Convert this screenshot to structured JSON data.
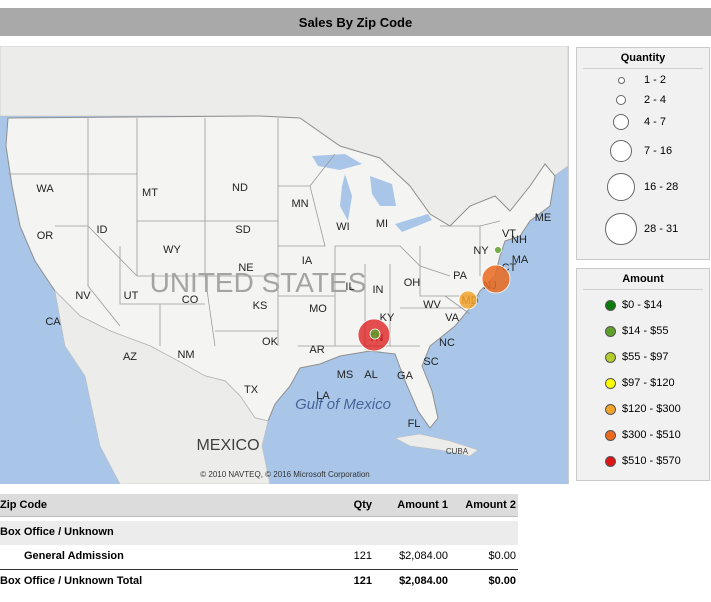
{
  "report": {
    "title": "Sales By Zip Code"
  },
  "map": {
    "copyright": "© 2010 NAVTEQ, © 2016 Microsoft Corporation",
    "country_label": "UNITED STATES",
    "water_label": "Gulf of Mexico",
    "neighbor_labels": [
      "MEXICO",
      "CUBA"
    ],
    "state_labels": [
      "WA",
      "MT",
      "ND",
      "MN",
      "OR",
      "ID",
      "SD",
      "WI",
      "MI",
      "WY",
      "NE",
      "IA",
      "NV",
      "UT",
      "CO",
      "IL",
      "IN",
      "OH",
      "PA",
      "NY",
      "VT",
      "NH",
      "ME",
      "MA",
      "CT",
      "NJ",
      "MD",
      "WV",
      "VA",
      "KS",
      "MO",
      "KY",
      "CA",
      "OK",
      "TN",
      "NC",
      "AR",
      "AZ",
      "NM",
      "SC",
      "MS",
      "AL",
      "GA",
      "TX",
      "LA",
      "FL"
    ],
    "colors": {
      "land": "#f4f4f2",
      "water": "#a9c6e8",
      "border": "#9a9a9a"
    }
  },
  "quantity_legend": {
    "title": "Quantity",
    "items": [
      "1 - 2",
      "2 - 4",
      "4 - 7",
      "7 - 16",
      "16 - 28",
      "28 - 31"
    ]
  },
  "amount_legend": {
    "title": "Amount",
    "items": [
      {
        "label": "$0 - $14",
        "color": "#0a7a0a"
      },
      {
        "label": "$14 - $55",
        "color": "#5ea02a"
      },
      {
        "label": "$55 - $97",
        "color": "#b4cc2e"
      },
      {
        "label": "$97 - $120",
        "color": "#ffff00"
      },
      {
        "label": "$120 - $300",
        "color": "#f2a32c"
      },
      {
        "label": "$300 - $510",
        "color": "#ea6a1e"
      },
      {
        "label": "$510 - $570",
        "color": "#dd1515"
      }
    ]
  },
  "bubbles": [
    {
      "location": "TN",
      "quantity_range": "28 - 31",
      "amount_range": "$510 - $570",
      "color": "#dd1515"
    },
    {
      "location": "TN",
      "quantity_range": "1 - 2",
      "amount_range": "$0 - $14",
      "color": "#5ea02a"
    },
    {
      "location": "NJ",
      "quantity_range": "16 - 28",
      "amount_range": "$300 - $510",
      "color": "#ea6a1e"
    },
    {
      "location": "MD",
      "quantity_range": "4 - 7",
      "amount_range": "$120 - $300",
      "color": "#f2a32c"
    },
    {
      "location": "NY",
      "quantity_range": "1 - 2",
      "amount_range": "$14 - $55",
      "color": "#5ea02a"
    }
  ],
  "table": {
    "headers": {
      "zip": "Zip Code",
      "qty": "Qty",
      "amount1": "Amount 1",
      "amount2": "Amount 2"
    },
    "group": {
      "label": "Box Office / Unknown"
    },
    "detail": {
      "label": "General Admission",
      "qty": "121",
      "amount1": "$2,084.00",
      "amount2": "$0.00"
    },
    "total": {
      "label": "Box Office / Unknown Total",
      "qty": "121",
      "amount1": "$2,084.00",
      "amount2": "$0.00"
    }
  }
}
